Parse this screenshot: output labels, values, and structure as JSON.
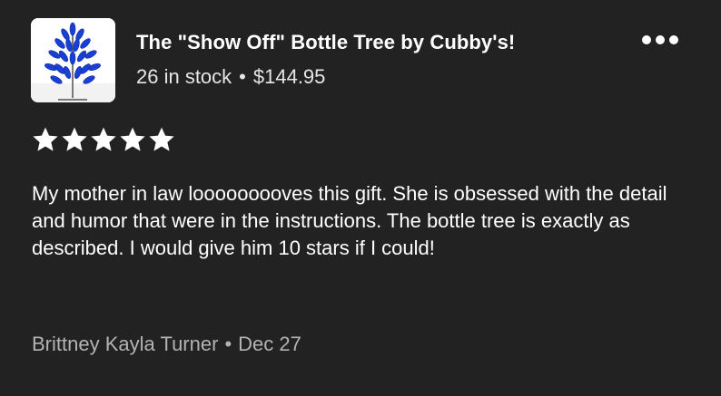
{
  "listing": {
    "title": "The \"Show Off\" Bottle Tree by Cubby's!",
    "stock": "26 in stock",
    "separator": "•",
    "price": "$144.95",
    "thumbnail_icon": "bottle-tree-image"
  },
  "menu": {
    "icon": "more-options-icon"
  },
  "rating": {
    "stars": 5,
    "max": 5,
    "star_color": "#ffffff"
  },
  "review": {
    "text": "My mother in law looooooooves this gift. She is obsessed with the detail and humor that were in the instructions. The bottle tree is exactly as described. I would give him 10 stars if I could!"
  },
  "reviewer": {
    "name": "Brittney Kayla Turner",
    "separator": "•",
    "date": "Dec 27"
  },
  "colors": {
    "background": "#222222",
    "text_primary": "#ffffff",
    "text_secondary": "#b3b3b3",
    "bottle_blue": "#1a3fd6"
  }
}
